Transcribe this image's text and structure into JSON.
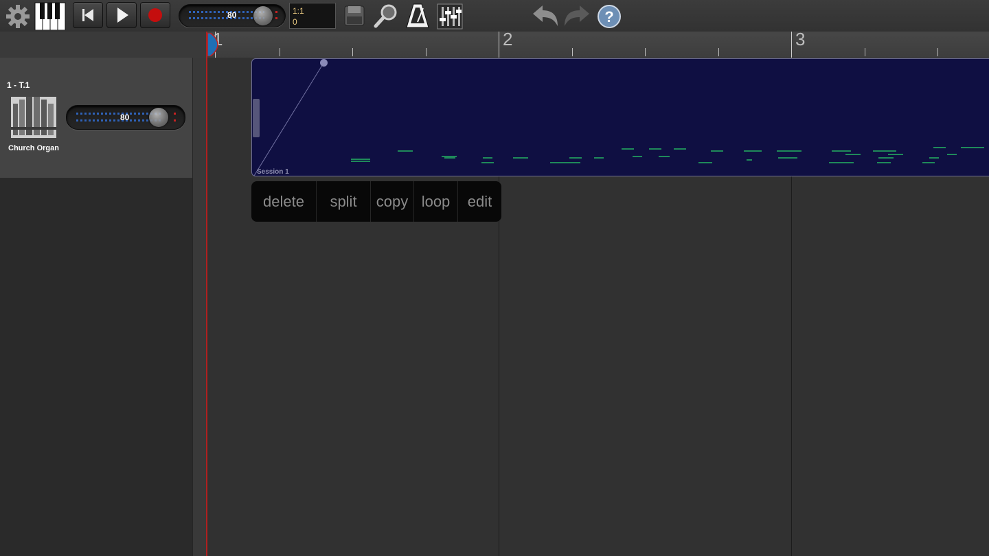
{
  "toolbar": {
    "master_volume": "80",
    "position_bar_beat": "1:1",
    "position_tick": "0"
  },
  "ruler": {
    "bars": [
      "1",
      "2",
      "3"
    ]
  },
  "track": {
    "name": "1 - T.1",
    "instrument": "Church Organ",
    "volume": "80"
  },
  "clip": {
    "name": "Session 1"
  },
  "context_menu": {
    "items": [
      "delete",
      "split",
      "copy",
      "loop",
      "edit"
    ]
  },
  "colors": {
    "clip_bg": "#0f0f42",
    "note": "#1f8a5a",
    "playhead": "#b02020",
    "slider_dots": "#2f62b8"
  }
}
